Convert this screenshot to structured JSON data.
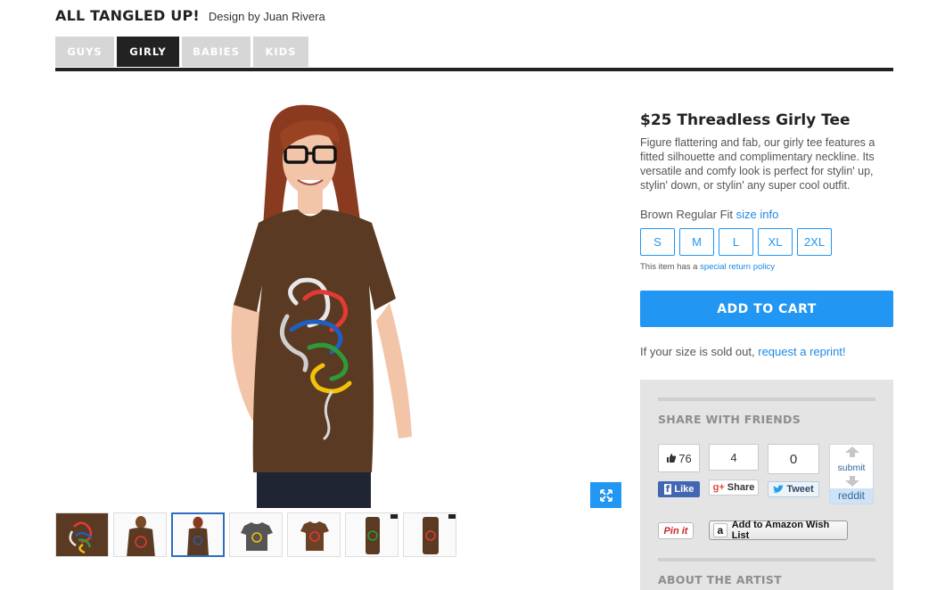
{
  "header": {
    "title": "ALL TANGLED UP!",
    "byline": "Design by Juan Rivera"
  },
  "tabs": [
    {
      "label": "GUYS",
      "active": false
    },
    {
      "label": "GIRLY",
      "active": true
    },
    {
      "label": "BABIES",
      "active": false
    },
    {
      "label": "KIDS",
      "active": false
    }
  ],
  "product": {
    "title": "$25 Threadless Girly Tee",
    "description": "Figure flattering and fab, our girly tee features a fitted silhouette and complimentary neckline. Its versatile and comfy look is perfect for stylin' up, stylin' down, or stylin' any super cool outfit.",
    "fit_label": "Brown Regular Fit",
    "size_info_link": "size info",
    "sizes": [
      "S",
      "M",
      "L",
      "XL",
      "2XL"
    ],
    "return_text": "This item has a",
    "return_link": "special return policy",
    "add_to_cart": "ADD TO CART",
    "soldout_text": "If your size is sold out,",
    "reprint_link": "request a reprint!"
  },
  "share": {
    "heading": "SHARE WITH FRIENDS",
    "fb_count": "76",
    "fb_label": "Like",
    "gplus_count": "4",
    "gplus_label": "Share",
    "tweet_count": "0",
    "tweet_label": "Tweet",
    "reddit_submit": "submit",
    "reddit_label": "reddit",
    "pinit_label": "Pin it",
    "amazon_label": "Add to Amazon Wish List"
  },
  "about": {
    "heading": "ABOUT THE ARTIST"
  },
  "colors": {
    "accent": "#2196f3",
    "tshirt": "#5a3a22",
    "dark": "#222222"
  },
  "icons": {
    "zoom": "expand-arrows-icon",
    "like": "thumbs-up-icon",
    "gplus": "google-plus-icon",
    "twitter": "twitter-bird-icon",
    "amazon": "amazon-logo-icon"
  }
}
